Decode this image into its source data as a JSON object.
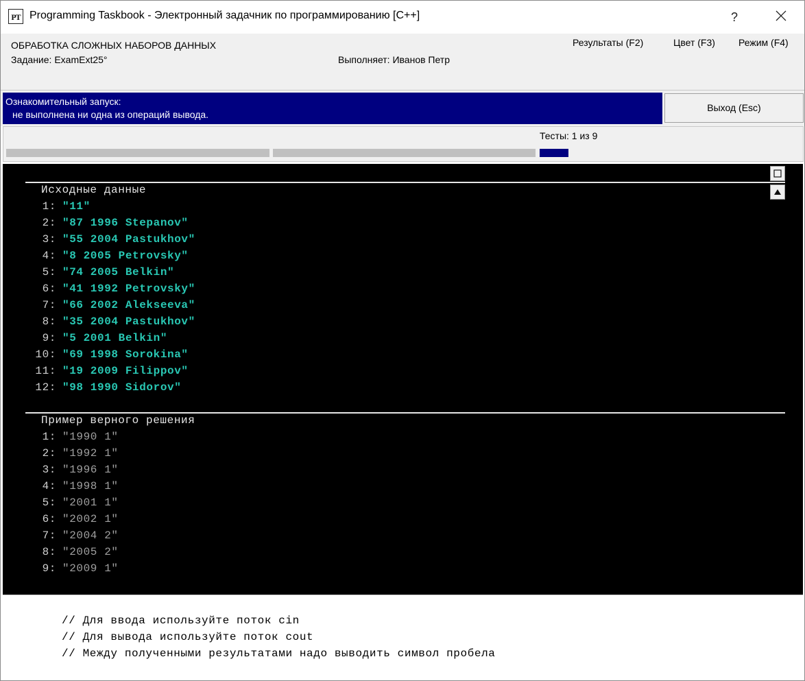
{
  "window": {
    "title": "Programming Taskbook - Электронный задачник по программированию [C++]",
    "icon_text": "PT",
    "help_label": "?"
  },
  "header": {
    "section_title": "ОБРАБОТКА СЛОЖНЫХ НАБОРОВ ДАННЫХ",
    "task_label": "Задание: ExamExt25°",
    "executor": "Выполняет: Иванов Петр",
    "menu": [
      {
        "label": "Результаты (F2)"
      },
      {
        "label": "Цвет (F3)"
      },
      {
        "label": "Режим (F4)"
      }
    ]
  },
  "status": {
    "line1": "Ознакомительный запуск:",
    "line2": "не выполнена ни одна из операций вывода.",
    "exit_label": "Выход (Esc)"
  },
  "tests": {
    "label": "Тесты:  1 из 9",
    "current": 1,
    "total": 9,
    "colors": {
      "done": "#c0c0c0",
      "current": "#000080"
    }
  },
  "console": {
    "input_title": "Исходные данные",
    "input_rows": [
      {
        "num": "1:",
        "value": "\"11\""
      },
      {
        "num": "2:",
        "value": "\"87 1996 Stepanov\""
      },
      {
        "num": "3:",
        "value": "\"55 2004 Pastukhov\""
      },
      {
        "num": "4:",
        "value": "\"8 2005 Petrovsky\""
      },
      {
        "num": "5:",
        "value": "\"74 2005 Belkin\""
      },
      {
        "num": "6:",
        "value": "\"41 1992 Petrovsky\""
      },
      {
        "num": "7:",
        "value": "\"66 2002 Alekseeva\""
      },
      {
        "num": "8:",
        "value": "\"35 2004 Pastukhov\""
      },
      {
        "num": "9:",
        "value": "\"5 2001 Belkin\""
      },
      {
        "num": "10:",
        "value": "\"69 1998 Sorokina\""
      },
      {
        "num": "11:",
        "value": "\"19 2009 Filippov\""
      },
      {
        "num": "12:",
        "value": "\"98 1990 Sidorov\""
      }
    ],
    "example_title": "Пример верного решения",
    "example_rows": [
      {
        "num": "1:",
        "value": "\"1990 1\""
      },
      {
        "num": "2:",
        "value": "\"1992 1\""
      },
      {
        "num": "3:",
        "value": "\"1996 1\""
      },
      {
        "num": "4:",
        "value": "\"1998 1\""
      },
      {
        "num": "5:",
        "value": "\"2001 1\""
      },
      {
        "num": "6:",
        "value": "\"2002 1\""
      },
      {
        "num": "7:",
        "value": "\"2004 2\""
      },
      {
        "num": "8:",
        "value": "\"2005 2\""
      },
      {
        "num": "9:",
        "value": "\"2009 1\""
      }
    ],
    "colors": {
      "background": "#000000",
      "input_value": "#29c8b4",
      "example_value": "#a0a0a0"
    }
  },
  "comments": [
    "// Для ввода используйте поток cin",
    "// Для вывода используйте поток cout",
    "// Между полученными результатами надо выводить символ пробела"
  ]
}
